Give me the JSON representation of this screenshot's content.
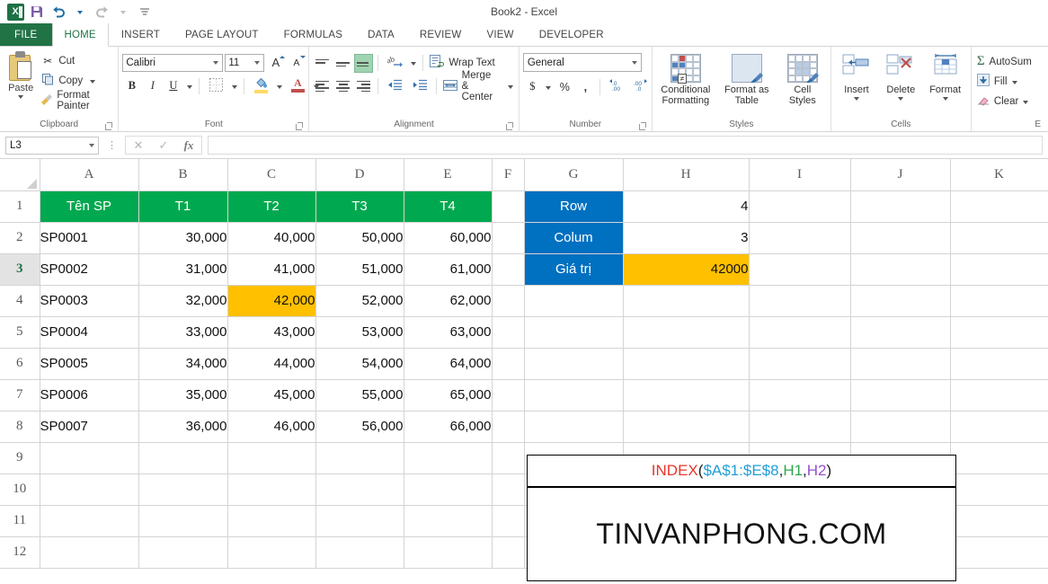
{
  "window": {
    "title": "Book2 - Excel",
    "quick_access": [
      "excel-logo",
      "save",
      "undo",
      "redo",
      "customize"
    ]
  },
  "ribbon": {
    "tabs": [
      {
        "label": "FILE",
        "active": false,
        "is_file": true
      },
      {
        "label": "HOME",
        "active": true
      },
      {
        "label": "INSERT",
        "active": false
      },
      {
        "label": "PAGE LAYOUT",
        "active": false
      },
      {
        "label": "FORMULAS",
        "active": false
      },
      {
        "label": "DATA",
        "active": false
      },
      {
        "label": "REVIEW",
        "active": false
      },
      {
        "label": "VIEW",
        "active": false
      },
      {
        "label": "DEVELOPER",
        "active": false
      }
    ],
    "clipboard": {
      "group_label": "Clipboard",
      "paste_label": "Paste",
      "cut_label": "Cut",
      "copy_label": "Copy",
      "format_painter_label": "Format Painter"
    },
    "font": {
      "group_label": "Font",
      "font_name": "Calibri",
      "font_size": "11",
      "bold": "B",
      "italic": "I",
      "underline": "U"
    },
    "alignment": {
      "group_label": "Alignment",
      "wrap_text_label": "Wrap Text",
      "merge_center_label": "Merge & Center"
    },
    "number": {
      "group_label": "Number",
      "format": "General",
      "currency": "$",
      "percent": "%",
      "comma": ",",
      "increase_decimal": ".00",
      "decrease_decimal": ".00"
    },
    "styles": {
      "group_label": "Styles",
      "conditional_formatting": "Conditional\nFormatting",
      "conditional_formatting_l1": "Conditional",
      "conditional_formatting_l2": "Formatting",
      "format_as_table_l1": "Format as",
      "format_as_table_l2": "Table",
      "cell_styles_l1": "Cell",
      "cell_styles_l2": "Styles"
    },
    "cells": {
      "group_label": "Cells",
      "insert_label": "Insert",
      "delete_label": "Delete",
      "format_label": "Format"
    },
    "editing": {
      "group_label": "E",
      "autosum_label": "AutoSum",
      "fill_label": "Fill",
      "clear_label": "Clear"
    }
  },
  "formula_bar": {
    "name_box": "L3",
    "formula_value": "",
    "cancel_icon": "close-icon",
    "confirm_icon": "check-icon",
    "function_icon": "fx"
  },
  "sheet": {
    "columns": [
      "A",
      "B",
      "C",
      "D",
      "E",
      "F",
      "G",
      "H",
      "I",
      "J",
      "K"
    ],
    "selected_row": 3,
    "rows": [
      {
        "num": 1,
        "cells": {
          "A": {
            "v": "Tên SP",
            "style": "hdr-green"
          },
          "B": {
            "v": "T1",
            "style": "hdr-green"
          },
          "C": {
            "v": "T2",
            "style": "hdr-green"
          },
          "D": {
            "v": "T3",
            "style": "hdr-green"
          },
          "E": {
            "v": "T4",
            "style": "hdr-green"
          },
          "F": {
            "v": ""
          },
          "G": {
            "v": "Row",
            "style": "lbl-blue"
          },
          "H": {
            "v": "4",
            "style": "c-right"
          },
          "I": {
            "v": ""
          },
          "J": {
            "v": ""
          },
          "K": {
            "v": ""
          }
        }
      },
      {
        "num": 2,
        "cells": {
          "A": {
            "v": "SP0001",
            "style": "c-left"
          },
          "B": {
            "v": "30,000",
            "style": "c-right"
          },
          "C": {
            "v": "40,000",
            "style": "c-right"
          },
          "D": {
            "v": "50,000",
            "style": "c-right"
          },
          "E": {
            "v": "60,000",
            "style": "c-right"
          },
          "F": {
            "v": ""
          },
          "G": {
            "v": "Colum",
            "style": "lbl-blue"
          },
          "H": {
            "v": "3",
            "style": "c-right"
          },
          "I": {
            "v": ""
          },
          "J": {
            "v": ""
          },
          "K": {
            "v": ""
          }
        }
      },
      {
        "num": 3,
        "cells": {
          "A": {
            "v": "SP0002",
            "style": "c-left"
          },
          "B": {
            "v": "31,000",
            "style": "c-right"
          },
          "C": {
            "v": "41,000",
            "style": "c-right"
          },
          "D": {
            "v": "51,000",
            "style": "c-right"
          },
          "E": {
            "v": "61,000",
            "style": "c-right"
          },
          "F": {
            "v": ""
          },
          "G": {
            "v": "Giá trị",
            "style": "lbl-blue"
          },
          "H": {
            "v": "42000",
            "style": "c-right amber"
          },
          "I": {
            "v": ""
          },
          "J": {
            "v": ""
          },
          "K": {
            "v": ""
          }
        }
      },
      {
        "num": 4,
        "cells": {
          "A": {
            "v": "SP0003",
            "style": "c-left"
          },
          "B": {
            "v": "32,000",
            "style": "c-right"
          },
          "C": {
            "v": "42,000",
            "style": "c-right amber"
          },
          "D": {
            "v": "52,000",
            "style": "c-right"
          },
          "E": {
            "v": "62,000",
            "style": "c-right"
          },
          "F": {
            "v": ""
          },
          "G": {
            "v": ""
          },
          "H": {
            "v": ""
          },
          "I": {
            "v": ""
          },
          "J": {
            "v": ""
          },
          "K": {
            "v": ""
          }
        }
      },
      {
        "num": 5,
        "cells": {
          "A": {
            "v": "SP0004",
            "style": "c-left"
          },
          "B": {
            "v": "33,000",
            "style": "c-right"
          },
          "C": {
            "v": "43,000",
            "style": "c-right"
          },
          "D": {
            "v": "53,000",
            "style": "c-right"
          },
          "E": {
            "v": "63,000",
            "style": "c-right"
          },
          "F": {
            "v": ""
          },
          "G": {
            "v": ""
          },
          "H": {
            "v": ""
          },
          "I": {
            "v": ""
          },
          "J": {
            "v": ""
          },
          "K": {
            "v": ""
          }
        }
      },
      {
        "num": 6,
        "cells": {
          "A": {
            "v": "SP0005",
            "style": "c-left"
          },
          "B": {
            "v": "34,000",
            "style": "c-right"
          },
          "C": {
            "v": "44,000",
            "style": "c-right"
          },
          "D": {
            "v": "54,000",
            "style": "c-right"
          },
          "E": {
            "v": "64,000",
            "style": "c-right"
          },
          "F": {
            "v": ""
          },
          "G": {
            "v": ""
          },
          "H": {
            "v": ""
          },
          "I": {
            "v": ""
          },
          "J": {
            "v": ""
          },
          "K": {
            "v": ""
          }
        }
      },
      {
        "num": 7,
        "cells": {
          "A": {
            "v": "SP0006",
            "style": "c-left"
          },
          "B": {
            "v": "35,000",
            "style": "c-right"
          },
          "C": {
            "v": "45,000",
            "style": "c-right"
          },
          "D": {
            "v": "55,000",
            "style": "c-right"
          },
          "E": {
            "v": "65,000",
            "style": "c-right"
          },
          "F": {
            "v": ""
          },
          "G": {
            "v": ""
          },
          "H": {
            "v": ""
          },
          "I": {
            "v": ""
          },
          "J": {
            "v": ""
          },
          "K": {
            "v": ""
          }
        }
      },
      {
        "num": 8,
        "cells": {
          "A": {
            "v": "SP0007",
            "style": "c-left"
          },
          "B": {
            "v": "36,000",
            "style": "c-right"
          },
          "C": {
            "v": "46,000",
            "style": "c-right"
          },
          "D": {
            "v": "56,000",
            "style": "c-right"
          },
          "E": {
            "v": "66,000",
            "style": "c-right"
          },
          "F": {
            "v": ""
          },
          "G": {
            "v": ""
          },
          "H": {
            "v": ""
          },
          "I": {
            "v": ""
          },
          "J": {
            "v": ""
          },
          "K": {
            "v": ""
          }
        }
      },
      {
        "num": 9,
        "cells": {}
      },
      {
        "num": 10,
        "cells": {}
      },
      {
        "num": 11,
        "cells": {}
      },
      {
        "num": 12,
        "cells": {}
      }
    ]
  },
  "overlays": {
    "formula_text": {
      "func": "INDEX",
      "open_paren": "(",
      "range": "$A$1:$E$8",
      "comma1": ",",
      "arg_row": "H1",
      "comma2": ",",
      "arg_col": "H2",
      "close_paren": ")"
    },
    "brand_text": "TINVANPHONG.COM"
  },
  "colors": {
    "header_green": "#00a84f",
    "label_blue": "#0070c0",
    "highlight_amber": "#ffc000",
    "excel_green": "#217346",
    "formula_func": "#e8352b",
    "formula_range": "#1f9ed9",
    "formula_arg_row": "#2aa84a",
    "formula_arg_col": "#9a4fce"
  }
}
